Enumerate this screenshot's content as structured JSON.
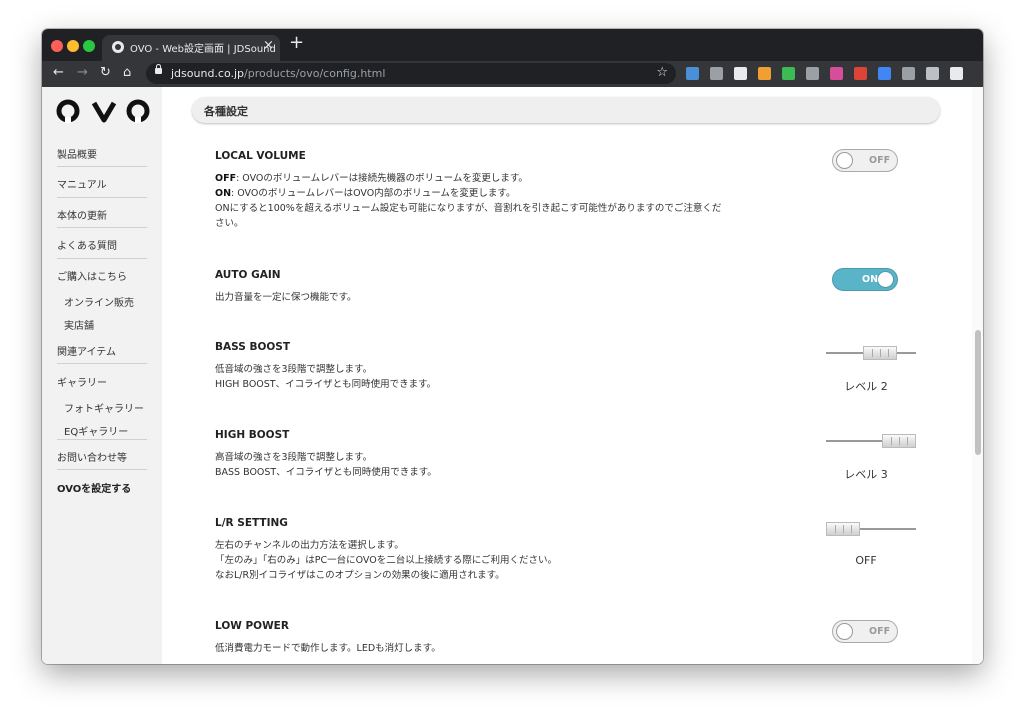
{
  "browser": {
    "tab_title": "OVO - Web設定画面 | JDSound",
    "tab_close": "×",
    "new_tab": "+",
    "url_host": "jdsound.co.jp",
    "url_path": "/products/ovo/config.html",
    "nav": {
      "back": "←",
      "forward": "→",
      "reload": "↻",
      "home": "⌂"
    },
    "star": "☆",
    "extension_colors": [
      "#4a90d9",
      "#9aa0a6",
      "#e8eaed",
      "#f0a030",
      "#3cba54",
      "#9aa0a6",
      "#d64d9a",
      "#db4437",
      "#4285f4",
      "#9aa0a6",
      "#bdc1c6",
      "#e8eaed"
    ]
  },
  "sidebar": {
    "logo": "OVO",
    "items": [
      {
        "label": "製品概要"
      },
      {
        "label": "マニュアル"
      },
      {
        "label": "本体の更新"
      },
      {
        "label": "よくある質問"
      },
      {
        "label": "ご購入はこちら"
      },
      {
        "label": "オンライン販売"
      },
      {
        "label": "実店舗"
      },
      {
        "label": "関連アイテム"
      },
      {
        "label": "ギャラリー"
      },
      {
        "label": "フォトギャラリー"
      },
      {
        "label": "EQギャラリー"
      },
      {
        "label": "お問い合わせ等"
      },
      {
        "label": "OVOを設定する"
      }
    ]
  },
  "main": {
    "header": "各種設定",
    "settings": [
      {
        "title": "LOCAL VOLUME",
        "lines": [
          {
            "bold": "OFF",
            "text": ": OVOのボリュームレバーは接続先機器のボリュームを変更します。"
          },
          {
            "bold": "ON",
            "text": ": OVOのボリュームレバーはOVO内部のボリュームを変更します。"
          },
          {
            "bold": "",
            "text": "ONにすると100%を超えるボリューム設定も可能になりますが、音割れを引き起こす可能性がありますのでご注意くだ"
          },
          {
            "bold": "",
            "text": "さい。"
          }
        ],
        "control": "OFF"
      },
      {
        "title": "AUTO GAIN",
        "lines": [
          {
            "bold": "",
            "text": "出力音量を一定に保つ機能です。"
          }
        ],
        "control": "ON"
      },
      {
        "title": "BASS BOOST",
        "lines": [
          {
            "bold": "",
            "text": "低音域の強さを3段階で調整します。"
          },
          {
            "bold": "",
            "text": "HIGH BOOST、イコライザとも同時使用できます。"
          }
        ],
        "level": 2,
        "level_max": 3,
        "value_label": "レベル 2"
      },
      {
        "title": "HIGH BOOST",
        "lines": [
          {
            "bold": "",
            "text": "高音域の強さを3段階で調整します。"
          },
          {
            "bold": "",
            "text": "BASS BOOST、イコライザとも同時使用できます。"
          }
        ],
        "level": 3,
        "level_max": 3,
        "value_label": "レベル 3"
      },
      {
        "title": "L/R SETTING",
        "lines": [
          {
            "bold": "",
            "text": "左右のチャンネルの出力方法を選択します。"
          },
          {
            "bold": "",
            "text": "「左のみ」「右のみ」はPC一台にOVOを二台以上接続する際にご利用ください。"
          },
          {
            "bold": "",
            "text": "なおL/R別イコライザはこのオプションの効果の後に適用されます。"
          }
        ],
        "level": 0,
        "level_max": 3,
        "value_label": "OFF"
      },
      {
        "title": "LOW POWER",
        "lines": [
          {
            "bold": "",
            "text": "低消費電力モードで動作します。LEDも消灯します。"
          }
        ],
        "control": "OFF"
      }
    ]
  }
}
